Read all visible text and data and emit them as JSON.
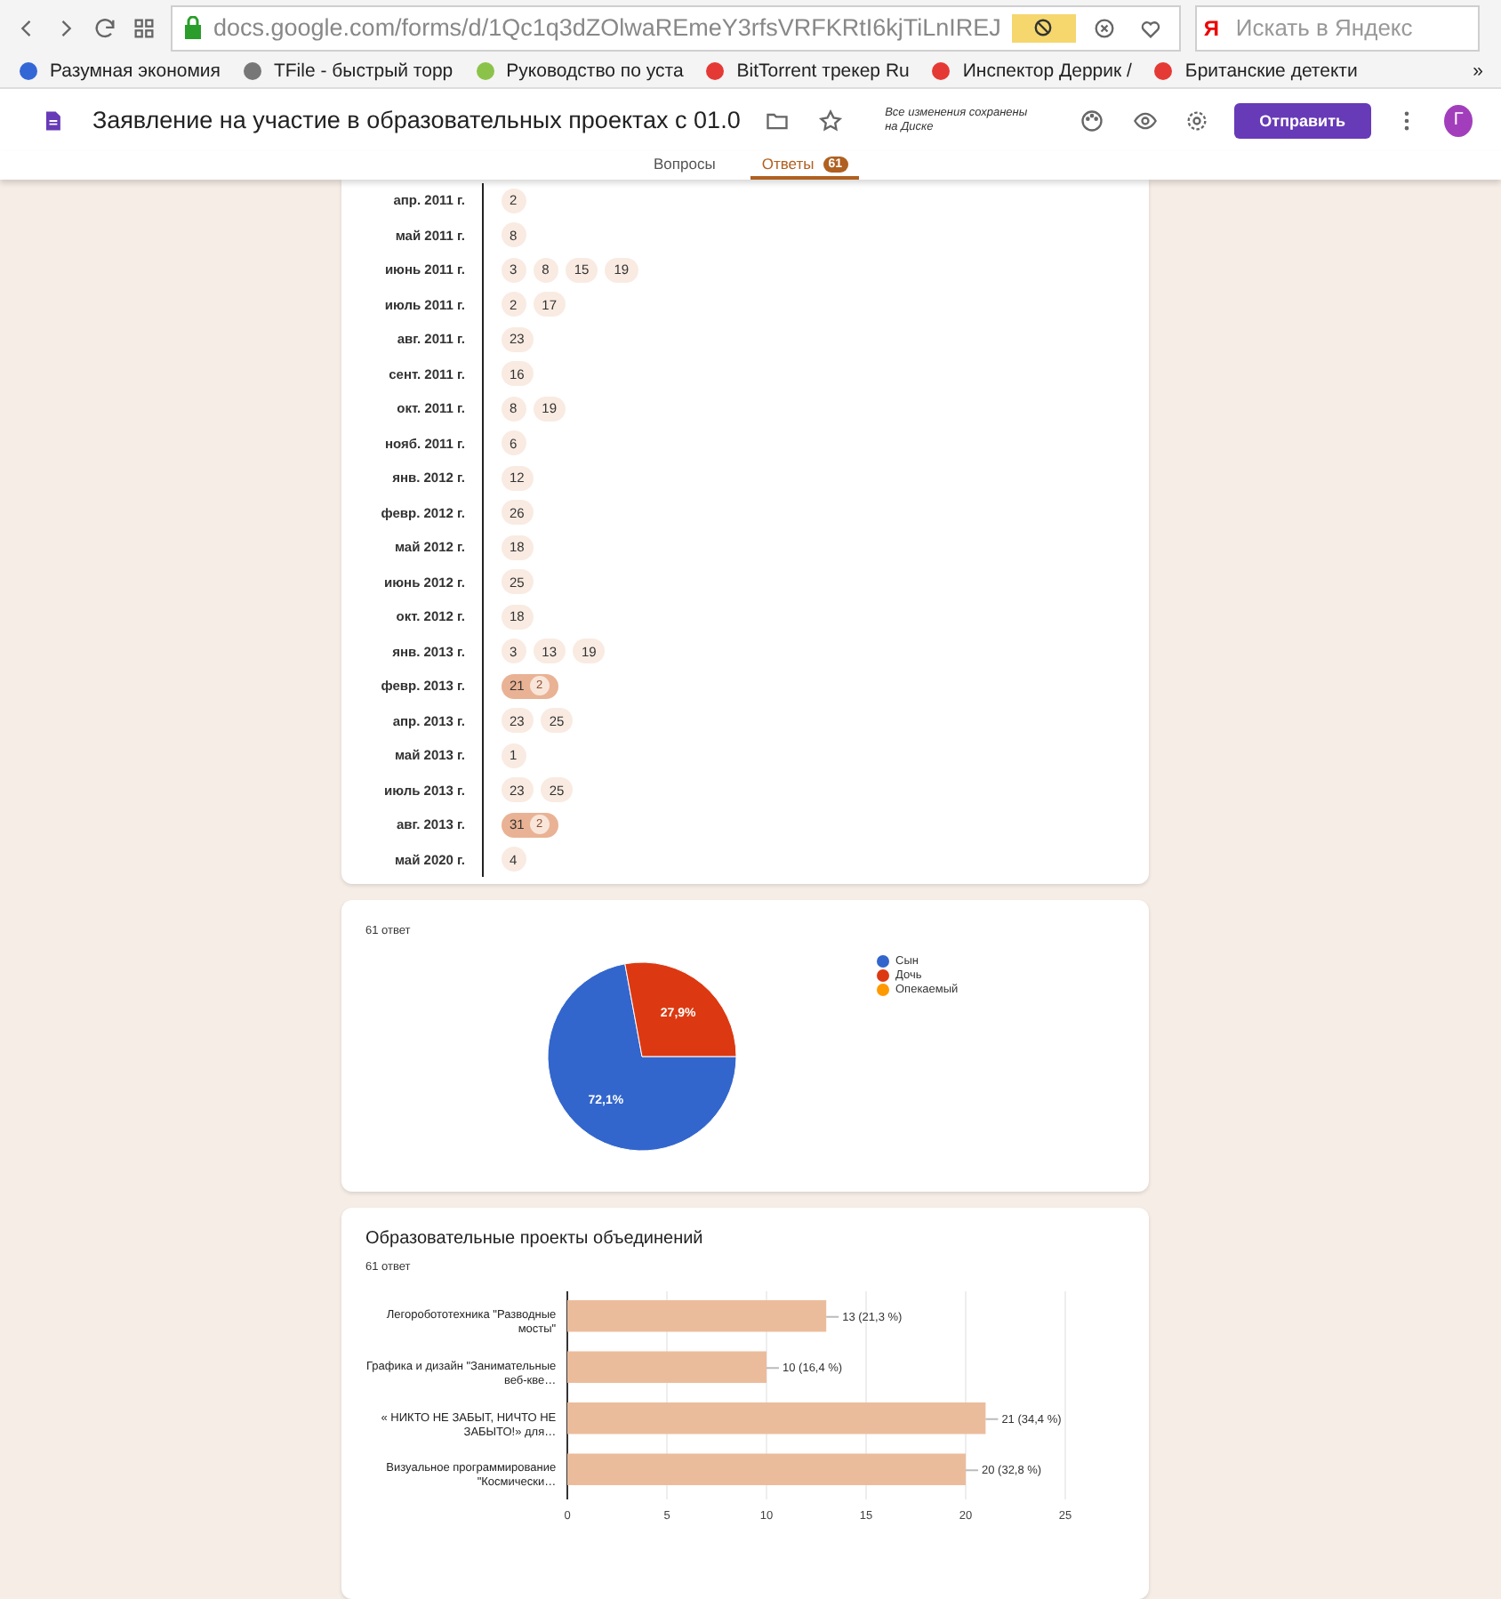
{
  "browser": {
    "url": "docs.google.com/forms/d/1Qc1q3dZOlwaREmeY3rfsVRFKRtI6kjTiLnIREJ",
    "search_placeholder": "Искать в Яндекс",
    "search_logo": "Я"
  },
  "bookmarks": [
    "Разумная экономия",
    "TFile - быстрый торр",
    "Руководство по уста",
    "BitTorrent трекер Ru",
    "Инспектор Деррик /",
    "Британские детекти"
  ],
  "bookmarks_more": "»",
  "form_header": {
    "title": "Заявление на участие в образовательных проектах с 01.0",
    "save_status": "Все изменения сохранены на Диске",
    "send_button": "Отправить",
    "avatar": "Г"
  },
  "tabs": [
    {
      "label": "Вопросы",
      "selected": false
    },
    {
      "label": "Ответы",
      "selected": true,
      "badge": "61"
    }
  ],
  "date_timeline": [
    {
      "month": "апр. 2011 г.",
      "days": [
        {
          "day": "2"
        }
      ]
    },
    {
      "month": "май 2011 г.",
      "days": [
        {
          "day": "8"
        }
      ]
    },
    {
      "month": "июнь 2011 г.",
      "days": [
        {
          "day": "3"
        },
        {
          "day": "8"
        },
        {
          "day": "15"
        },
        {
          "day": "19"
        }
      ]
    },
    {
      "month": "июль 2011 г.",
      "days": [
        {
          "day": "2"
        },
        {
          "day": "17"
        }
      ]
    },
    {
      "month": "авг. 2011 г.",
      "days": [
        {
          "day": "23"
        }
      ]
    },
    {
      "month": "сент. 2011 г.",
      "days": [
        {
          "day": "16"
        }
      ]
    },
    {
      "month": "окт. 2011 г.",
      "days": [
        {
          "day": "8"
        },
        {
          "day": "19"
        }
      ]
    },
    {
      "month": "нояб. 2011 г.",
      "days": [
        {
          "day": "6"
        }
      ]
    },
    {
      "month": "янв. 2012 г.",
      "days": [
        {
          "day": "12"
        }
      ]
    },
    {
      "month": "февр. 2012 г.",
      "days": [
        {
          "day": "26"
        }
      ]
    },
    {
      "month": "май 2012 г.",
      "days": [
        {
          "day": "18"
        }
      ]
    },
    {
      "month": "июнь 2012 г.",
      "days": [
        {
          "day": "25"
        }
      ]
    },
    {
      "month": "окт. 2012 г.",
      "days": [
        {
          "day": "18"
        }
      ]
    },
    {
      "month": "янв. 2013 г.",
      "days": [
        {
          "day": "3"
        },
        {
          "day": "13"
        },
        {
          "day": "19"
        }
      ]
    },
    {
      "month": "февр. 2013 г.",
      "days": [
        {
          "day": "21",
          "count": "2"
        }
      ]
    },
    {
      "month": "апр. 2013 г.",
      "days": [
        {
          "day": "23"
        },
        {
          "day": "25"
        }
      ]
    },
    {
      "month": "май 2013 г.",
      "days": [
        {
          "day": "1"
        }
      ]
    },
    {
      "month": "июль 2013 г.",
      "days": [
        {
          "day": "23"
        },
        {
          "day": "25"
        }
      ]
    },
    {
      "month": "авг. 2013 г.",
      "days": [
        {
          "day": "31",
          "count": "2"
        }
      ]
    },
    {
      "month": "май 2020 г.",
      "days": [
        {
          "day": "4"
        }
      ]
    }
  ],
  "relation_card": {
    "response_count": "61 ответ",
    "chart_data": {
      "type": "pie",
      "categories": [
        "Сын",
        "Дочь",
        "Опекаемый"
      ],
      "values": [
        72.1,
        27.9,
        0
      ],
      "colors": [
        "#3366cc",
        "#dc3912",
        "#ff9900"
      ],
      "value_labels": [
        "72,1%",
        "27,9%",
        null
      ]
    }
  },
  "projects_card": {
    "title": "Образовательные проекты объединений",
    "response_count": "61 ответ",
    "chart_data": {
      "type": "bar",
      "orientation": "horizontal",
      "categories": [
        "Легоробототехника \"Разводные мосты\"",
        "Графика и дизайн \"Занимательные веб-кве…",
        "« НИКТО НЕ ЗАБЫТ, НИЧТО НЕ ЗАБЫТО!» для…",
        "Визуальное программирование \"Космически…"
      ],
      "series": [
        {
          "color": "#ebbc9c",
          "values": [
            13,
            10,
            21,
            20
          ]
        }
      ],
      "grid": true,
      "value_labels": [
        "13 (21,3 %)",
        "10 (16,4 %)",
        "21 (34,4 %)",
        "20 (32,8 %)"
      ],
      "xlim": [
        0,
        25
      ],
      "xticks": [
        0,
        5,
        10,
        15,
        20,
        25
      ]
    }
  }
}
